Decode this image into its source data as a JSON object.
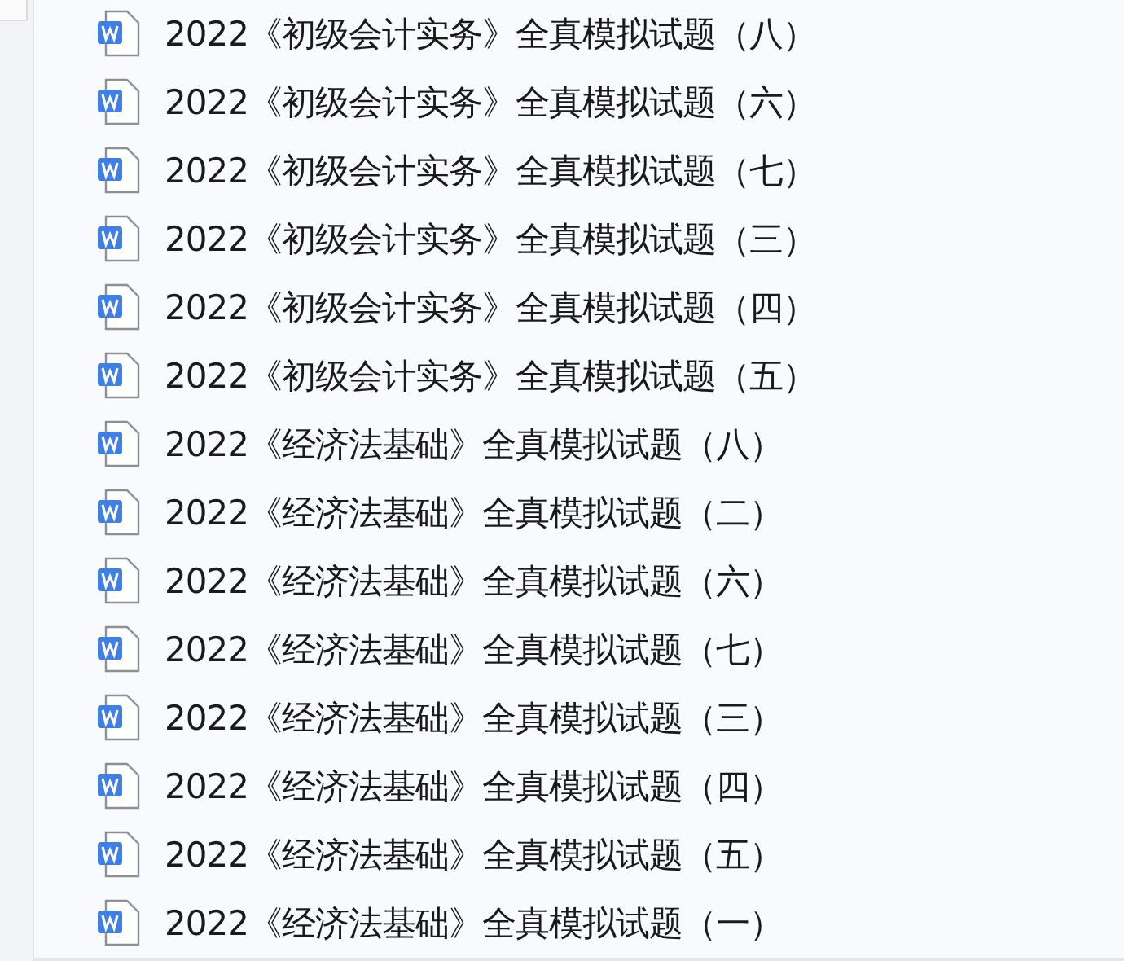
{
  "files": [
    {
      "name": "2022《初级会计实务》全真模拟试题（八）"
    },
    {
      "name": "2022《初级会计实务》全真模拟试题（六）"
    },
    {
      "name": "2022《初级会计实务》全真模拟试题（七）"
    },
    {
      "name": "2022《初级会计实务》全真模拟试题（三）"
    },
    {
      "name": "2022《初级会计实务》全真模拟试题（四）"
    },
    {
      "name": "2022《初级会计实务》全真模拟试题（五）"
    },
    {
      "name": "2022《经济法基础》全真模拟试题（八）"
    },
    {
      "name": "2022《经济法基础》全真模拟试题（二）"
    },
    {
      "name": "2022《经济法基础》全真模拟试题（六）"
    },
    {
      "name": "2022《经济法基础》全真模拟试题（七）"
    },
    {
      "name": "2022《经济法基础》全真模拟试题（三）"
    },
    {
      "name": "2022《经济法基础》全真模拟试题（四）"
    },
    {
      "name": "2022《经济法基础》全真模拟试题（五）"
    },
    {
      "name": "2022《经济法基础》全真模拟试题（一）"
    }
  ]
}
